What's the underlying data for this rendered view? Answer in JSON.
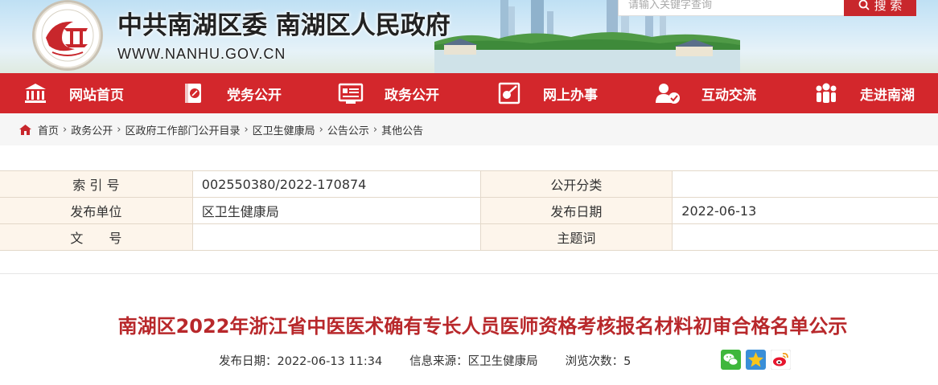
{
  "header": {
    "title": "中共南湖区委 南湖区人民政府",
    "domain": "WWW.NANHU.GOV.CN",
    "search_placeholder": "请输入关键字查询",
    "search_button": "搜 索"
  },
  "nav": {
    "items": [
      {
        "label": "网站首页",
        "icon": "government-building-icon"
      },
      {
        "label": "党务公开",
        "icon": "party-emblem-book-icon"
      },
      {
        "label": "政务公开",
        "icon": "bulletin-board-icon"
      },
      {
        "label": "网上办事",
        "icon": "online-service-icon"
      },
      {
        "label": "互动交流",
        "icon": "user-chat-icon"
      },
      {
        "label": "走进南湖",
        "icon": "people-group-icon"
      }
    ]
  },
  "breadcrumb": [
    "首页",
    "政务公开",
    "区政府工作部门公开目录",
    "区卫生健康局",
    "公告公示",
    "其他公告"
  ],
  "info": {
    "index_label": "索 引 号",
    "index_value": "002550380/2022-170874",
    "category_label": "公开分类",
    "category_value": "",
    "publisher_label": "发布单位",
    "publisher_value": "区卫生健康局",
    "date_label": "发布日期",
    "date_value": "2022-06-13",
    "docno_label": "文　　号",
    "docno_value": "",
    "topic_label": "主题词",
    "topic_value": ""
  },
  "article": {
    "title": "南湖区2022年浙江省中医医术确有专长人员医师资格考核报名材料初审合格名单公示",
    "date_label": "发布日期：",
    "date_value": "2022-06-13 11:34",
    "source_label": "信息来源：",
    "source_value": "区卫生健康局",
    "views_label": "浏览次数：",
    "views_value": "5"
  },
  "colors": {
    "brand_red": "#d3272c",
    "title_red": "#b8282b",
    "label_bg": "#fdf5eb"
  }
}
